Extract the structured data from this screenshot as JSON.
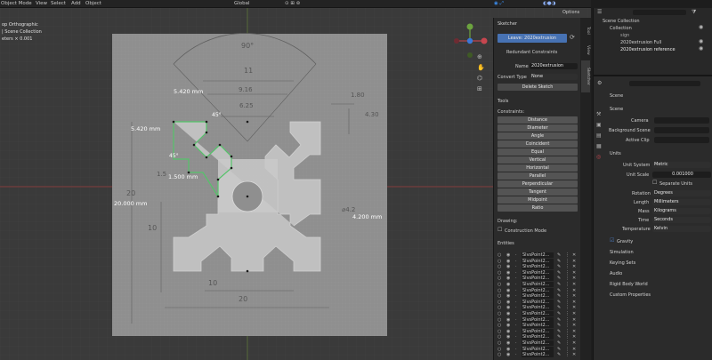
{
  "header": {
    "menus": [
      "Object Mode",
      "View",
      "Select",
      "Add",
      "Object"
    ],
    "transform_orientation": "Global",
    "options_label": "Options"
  },
  "viewport": {
    "overlay": [
      "op Orthographic",
      "| Scene Collection",
      "eters × 0.001"
    ]
  },
  "sketch": {
    "dims": {
      "top_90": "90°",
      "d11": "11",
      "d916": "9.16",
      "d625": "6.25",
      "d180": "1.80",
      "d430": "4.30",
      "d5420_a": "5.420 mm",
      "d5420_b": "5.420 mm",
      "d45_a": "45°",
      "d45_b": "45°",
      "d1500": "1.500 mm",
      "d20": "20",
      "d20000": "20.000 mm",
      "d10": "10",
      "d4200": "4.200 mm",
      "d42": "⌀4.2",
      "d10b": "10",
      "d20b": "20",
      "d15": "1.5"
    }
  },
  "sketcher": {
    "title": "Sketcher",
    "leave_label": "Leave: 2020extrusion",
    "redundant_label": "Redundant Constraints",
    "name_label": "Name",
    "name_value": "2020extrusion",
    "convert_label": "Convert Type",
    "convert_value": "None",
    "delete_label": "Delete Sketch",
    "tools_label": "Tools",
    "constraints_label": "Constraints:",
    "constraints": [
      "Distance",
      "Diameter",
      "Angle",
      "Coincident",
      "Equal",
      "Vertical",
      "Horizontal",
      "Parallel",
      "Perpendicular",
      "Tangent",
      "Midpoint",
      "Ratio"
    ],
    "drawing_label": "Drawing:",
    "construction_label": "Construction Mode",
    "entities_label": "Entities",
    "entities": [
      "SlvsPoint2...",
      "SlvsPoint2...",
      "SlvsPoint2...",
      "SlvsPoint2...",
      "SlvsPoint2...",
      "SlvsPoint2...",
      "SlvsPoint2...",
      "SlvsPoint2...",
      "SlvsPoint2...",
      "SlvsPoint2...",
      "SlvsPoint2...",
      "SlvsPoint2...",
      "SlvsPoint2...",
      "SlvsPoint2...",
      "SlvsPoint2...",
      "SlvsPoint2...",
      "SlvsPoint2...",
      "SlvsPoint2..."
    ]
  },
  "tabs": [
    "Tool",
    "View",
    "Sketcher"
  ],
  "outliner": {
    "title": "Scene Collection",
    "items": [
      "Collection",
      "sign",
      "2020extrusion Full",
      "2020extrusion reference"
    ]
  },
  "properties": {
    "scene_label": "Scene",
    "scene_section": "Scene",
    "camera_label": "Camera",
    "bg_scene_label": "Background Scene",
    "active_clip_label": "Active Clip",
    "units_section": "Units",
    "unit_system_label": "Unit System",
    "unit_system_value": "Metric",
    "unit_scale_label": "Unit Scale",
    "unit_scale_value": "0.001000",
    "separate_units_label": "Separate Units",
    "rotation_label": "Rotation",
    "rotation_value": "Degrees",
    "length_label": "Length",
    "length_value": "Millimeters",
    "mass_label": "Mass",
    "mass_value": "Kilograms",
    "time_label": "Time",
    "time_value": "Seconds",
    "temperature_label": "Temperature",
    "temperature_value": "Kelvin",
    "panels": [
      "Gravity",
      "Simulation",
      "Keying Sets",
      "Audio",
      "Rigid Body World",
      "Custom Properties"
    ]
  },
  "colors": {
    "accent": "#4772b3",
    "sketch_green": "#55c36a",
    "sketch_edge": "#d8d8d8",
    "paper": "#8f8f8f"
  }
}
